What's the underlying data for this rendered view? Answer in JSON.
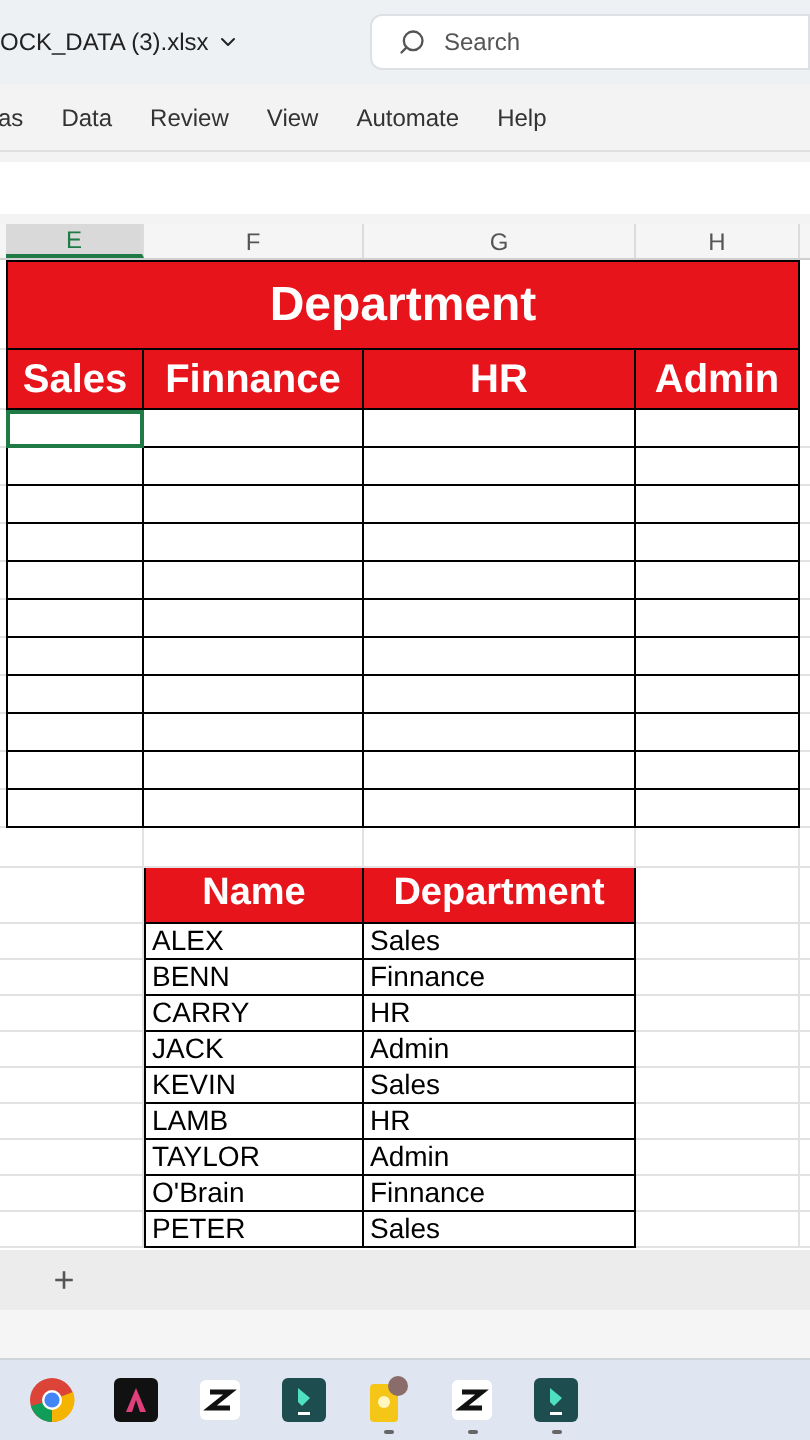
{
  "title_bar": {
    "filename": "OCK_DATA (3).xlsx",
    "search": {
      "placeholder": "Search"
    }
  },
  "ribbon_tabs": [
    {
      "label": "as",
      "selected": false
    },
    {
      "label": "Data",
      "selected": false
    },
    {
      "label": "Review",
      "selected": false
    },
    {
      "label": "View",
      "selected": false
    },
    {
      "label": "Automate",
      "selected": false
    },
    {
      "label": "Help",
      "selected": false
    }
  ],
  "column_headers": [
    {
      "label": "E",
      "selected": true
    },
    {
      "label": "F",
      "selected": false
    },
    {
      "label": "G",
      "selected": false
    },
    {
      "label": "H",
      "selected": false
    }
  ],
  "summary_table": {
    "title": "Department",
    "columns": [
      "Sales",
      "Finnance",
      "HR",
      "Admin"
    ]
  },
  "roster": {
    "columns": [
      "Name",
      "Department"
    ],
    "rows": [
      {
        "name": "ALEX",
        "department": "Sales"
      },
      {
        "name": "BENN",
        "department": "Finnance"
      },
      {
        "name": "CARRY",
        "department": "HR"
      },
      {
        "name": "JACK",
        "department": "Admin"
      },
      {
        "name": "KEVIN",
        "department": "Sales"
      },
      {
        "name": "LAMB",
        "department": "HR"
      },
      {
        "name": "TAYLOR",
        "department": "Admin"
      },
      {
        "name": "O'Brain",
        "department": "Finnance"
      },
      {
        "name": "PETER",
        "department": "Sales"
      }
    ]
  },
  "sheet_bar": {
    "add": "+"
  },
  "taskbar": [
    {
      "kind": "chrome",
      "running": false
    },
    {
      "kind": "adobe",
      "running": false
    },
    {
      "kind": "capcut",
      "running": false
    },
    {
      "kind": "filmora",
      "running": false
    },
    {
      "kind": "notes",
      "running": true
    },
    {
      "kind": "capcut",
      "running": true
    },
    {
      "kind": "filmora",
      "running": true
    }
  ]
}
